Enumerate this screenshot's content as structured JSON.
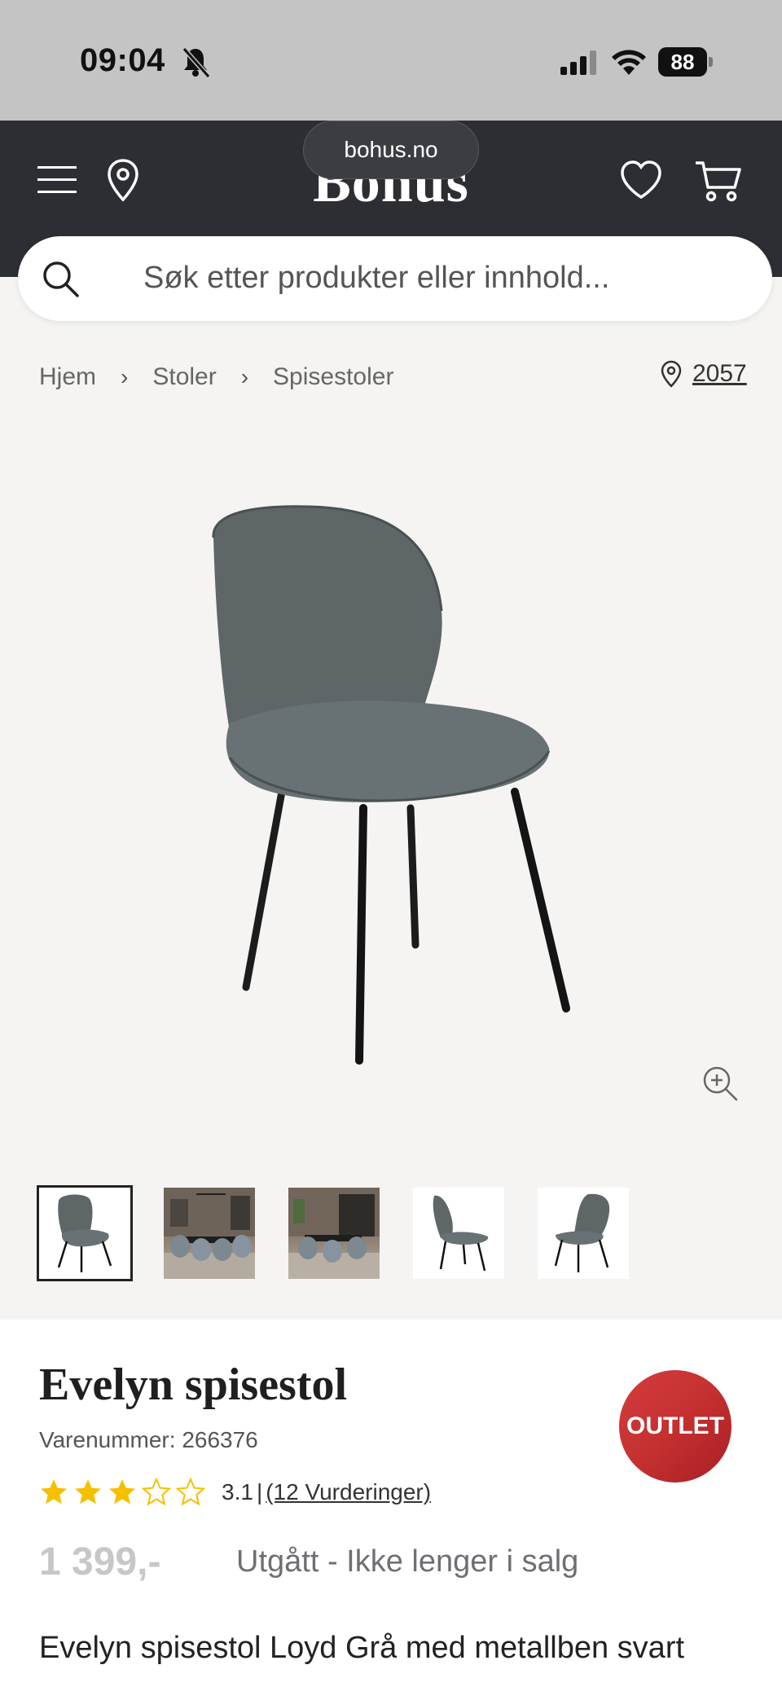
{
  "status_bar": {
    "time": "09:04",
    "battery": "88"
  },
  "browser": {
    "url": "bohus.no"
  },
  "header": {
    "logo": "Bohus"
  },
  "search": {
    "placeholder": "Søk etter produkter eller innhold..."
  },
  "breadcrumb": {
    "items": [
      "Hjem",
      "Stoler",
      "Spisestoler"
    ]
  },
  "store": {
    "number": "2057"
  },
  "product": {
    "title": "Evelyn spisestol",
    "sku": "Varenummer: 266376",
    "rating": {
      "value": "3.1",
      "stars": 3,
      "max": 5,
      "separator": "|",
      "reviews": "(12 Vurderinger)"
    },
    "price": "1 399,-",
    "availability": "Utgått - Ikke lenger i salg",
    "badge": "OUTLET",
    "description": "Evelyn spisestol Loyd Grå med metallben svart"
  },
  "colors": {
    "header": "#2d2e33",
    "badge": "#c53030",
    "star": "#f5c000",
    "page": "#f5f4f2"
  }
}
